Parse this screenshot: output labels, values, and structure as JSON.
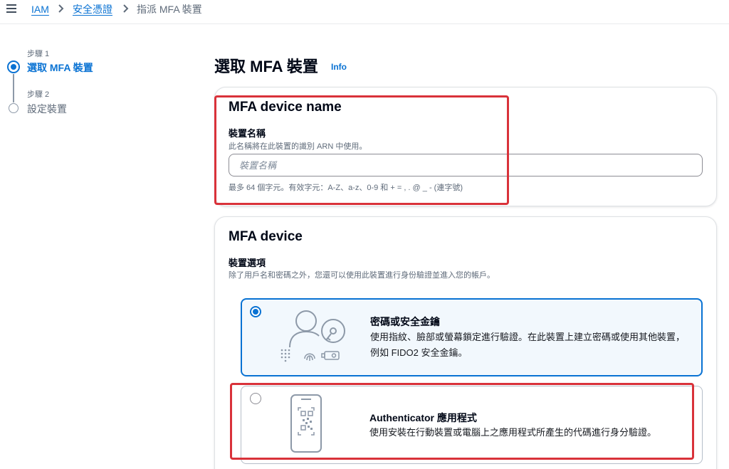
{
  "breadcrumb": {
    "items": [
      "IAM",
      "安全憑證",
      "指派 MFA 裝置"
    ]
  },
  "steps": [
    {
      "number": "步驟 1",
      "title": "選取 MFA 裝置",
      "state": "active"
    },
    {
      "number": "步驟 2",
      "title": "設定裝置",
      "state": "idle"
    }
  ],
  "page": {
    "title": "選取 MFA 裝置",
    "info": "Info"
  },
  "name_section": {
    "heading": "MFA device name",
    "label": "裝置名稱",
    "description": "此名稱將在此裝置的識別 ARN 中使用。",
    "placeholder": "裝置名稱",
    "value": "",
    "constraint": "最多 64 個字元。有效字元：A-Z、a-z、0-9 和 + = , . @ _ - (連字號)"
  },
  "device_section": {
    "heading": "MFA device",
    "label": "裝置選項",
    "description": "除了用戶名和密碼之外，您還可以使用此裝置進行身份驗證並進入您的帳戶。",
    "options": [
      {
        "title": "密碼或安全金鑰",
        "description": "使用指紋、臉部或螢幕鎖定進行驗證。在此裝置上建立密碼或使用其他裝置，例如 FIDO2 安全金鑰。",
        "selected": true,
        "icon": "passkey-icon"
      },
      {
        "title": "Authenticator 應用程式",
        "description": "使用安裝在行動裝置或電腦上之應用程式所產生的代碼進行身分驗證。",
        "selected": false,
        "icon": "authenticator-app-icon"
      }
    ]
  },
  "colors": {
    "link": "#0972d3",
    "annotation": "#d9323a",
    "selected_bg": "#f2f8fd"
  }
}
